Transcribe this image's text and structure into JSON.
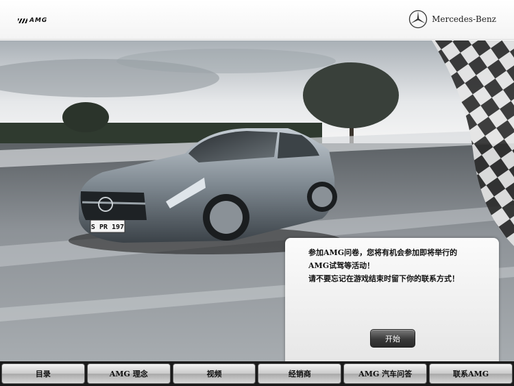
{
  "header": {
    "amg_logo_text": "AMG",
    "brand_name": "Mercedes-Benz"
  },
  "hero": {
    "license_plate": "S PR 197"
  },
  "dialog": {
    "line1": "参加AMG问卷，您将有机会参加即将举行的",
    "line2": "AMG试驾等活动！",
    "line3": "请不要忘记在游戏结束时留下你的联系方式！",
    "start_label": "开始"
  },
  "nav": {
    "items": [
      {
        "label": "目录"
      },
      {
        "label": "AMG 理念"
      },
      {
        "label": "视频"
      },
      {
        "label": "经销商"
      },
      {
        "label": "AMG 汽车问答"
      },
      {
        "label": "联系AMG"
      }
    ]
  },
  "colors": {
    "navbar_bg": "#1a1a1a",
    "dialog_bg": "#f0f0f0",
    "button_dark": "#3a3a3a"
  }
}
